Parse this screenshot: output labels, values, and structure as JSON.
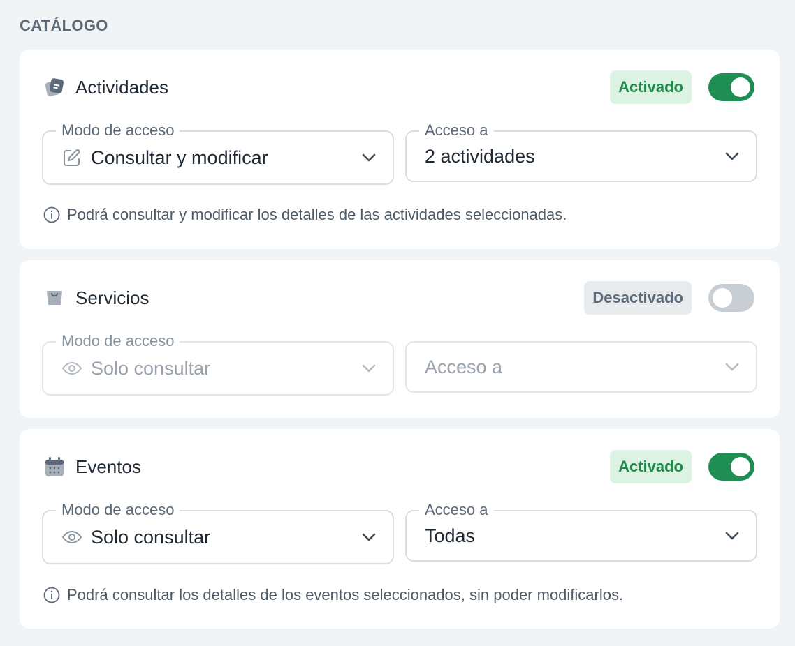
{
  "section": {
    "title": "CATÁLOGO"
  },
  "cards": [
    {
      "title": "Actividades",
      "icon": "ticket-icon",
      "status_label": "Activado",
      "enabled": true,
      "mode_label": "Modo de acceso",
      "mode_value": "Consultar y modificar",
      "mode_icon": "edit-icon",
      "access_label": "Acceso a",
      "access_value": "2 actividades",
      "hint": "Podrá consultar y modificar los detalles de las actividades seleccionadas."
    },
    {
      "title": "Servicios",
      "icon": "bag-icon",
      "status_label": "Desactivado",
      "enabled": false,
      "mode_label": "Modo de acceso",
      "mode_value": "Solo consultar",
      "mode_icon": "eye-icon",
      "access_value": "Acceso a"
    },
    {
      "title": "Eventos",
      "icon": "calendar-icon",
      "status_label": "Activado",
      "enabled": true,
      "mode_label": "Modo de acceso",
      "mode_value": "Solo consultar",
      "mode_icon": "eye-icon",
      "access_label": "Acceso a",
      "access_value": "Todas",
      "hint": "Podrá consultar los detalles de los eventos seleccionados, sin poder modificarlos."
    }
  ],
  "colors": {
    "accent_green": "#1e8e55",
    "badge_on_bg": "#dcf3e3",
    "badge_off_bg": "#e8ebee",
    "page_bg": "#f1f4f7"
  }
}
